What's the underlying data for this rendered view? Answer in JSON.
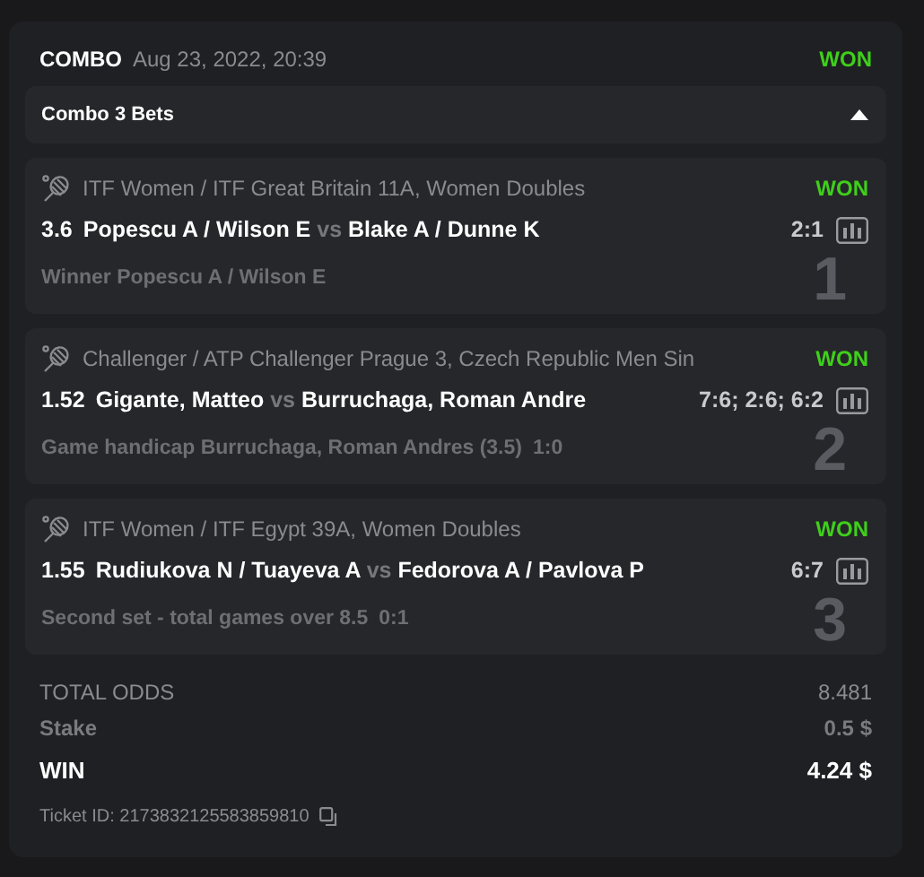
{
  "header": {
    "type": "COMBO",
    "date": "Aug 23, 2022, 20:39",
    "result": "WON"
  },
  "group": {
    "title": "Combo 3 Bets",
    "expanded": true
  },
  "bets": [
    {
      "number": "1",
      "league": "ITF Women / ITF Great Britain 11A, Women Doubles",
      "result": "WON",
      "odds": "3.6",
      "team1": "Popescu A / Wilson E",
      "vs": "vs",
      "team2": "Blake A / Dunne K",
      "score": "2:1",
      "market": "Winner Popescu A / Wilson E"
    },
    {
      "number": "2",
      "league": "Challenger / ATP Challenger Prague 3, Czech Republic Men Sin",
      "result": "WON",
      "odds": "1.52",
      "team1": "Gigante, Matteo",
      "vs": "vs",
      "team2": "Burruchaga, Roman Andre",
      "score": "7:6; 2:6; 6:2",
      "market": "Game handicap Burruchaga, Roman Andres (3.5)",
      "market_score": "1:0"
    },
    {
      "number": "3",
      "league": "ITF Women / ITF Egypt 39A, Women Doubles",
      "result": "WON",
      "odds": "1.55",
      "team1": "Rudiukova N / Tuayeva A",
      "vs": "vs",
      "team2": "Fedorova A / Pavlova P",
      "score": "6:7",
      "market": "Second set - total games over 8.5",
      "market_score": "0:1"
    }
  ],
  "summary": [
    {
      "kind": "odds",
      "label": "TOTAL ODDS",
      "value": "8.481"
    },
    {
      "kind": "stake",
      "label": "Stake",
      "value": "0.5 $"
    },
    {
      "kind": "win",
      "label": "WIN",
      "value": "4.24 $"
    }
  ],
  "ticket": "Ticket ID: 2173832125583859810"
}
